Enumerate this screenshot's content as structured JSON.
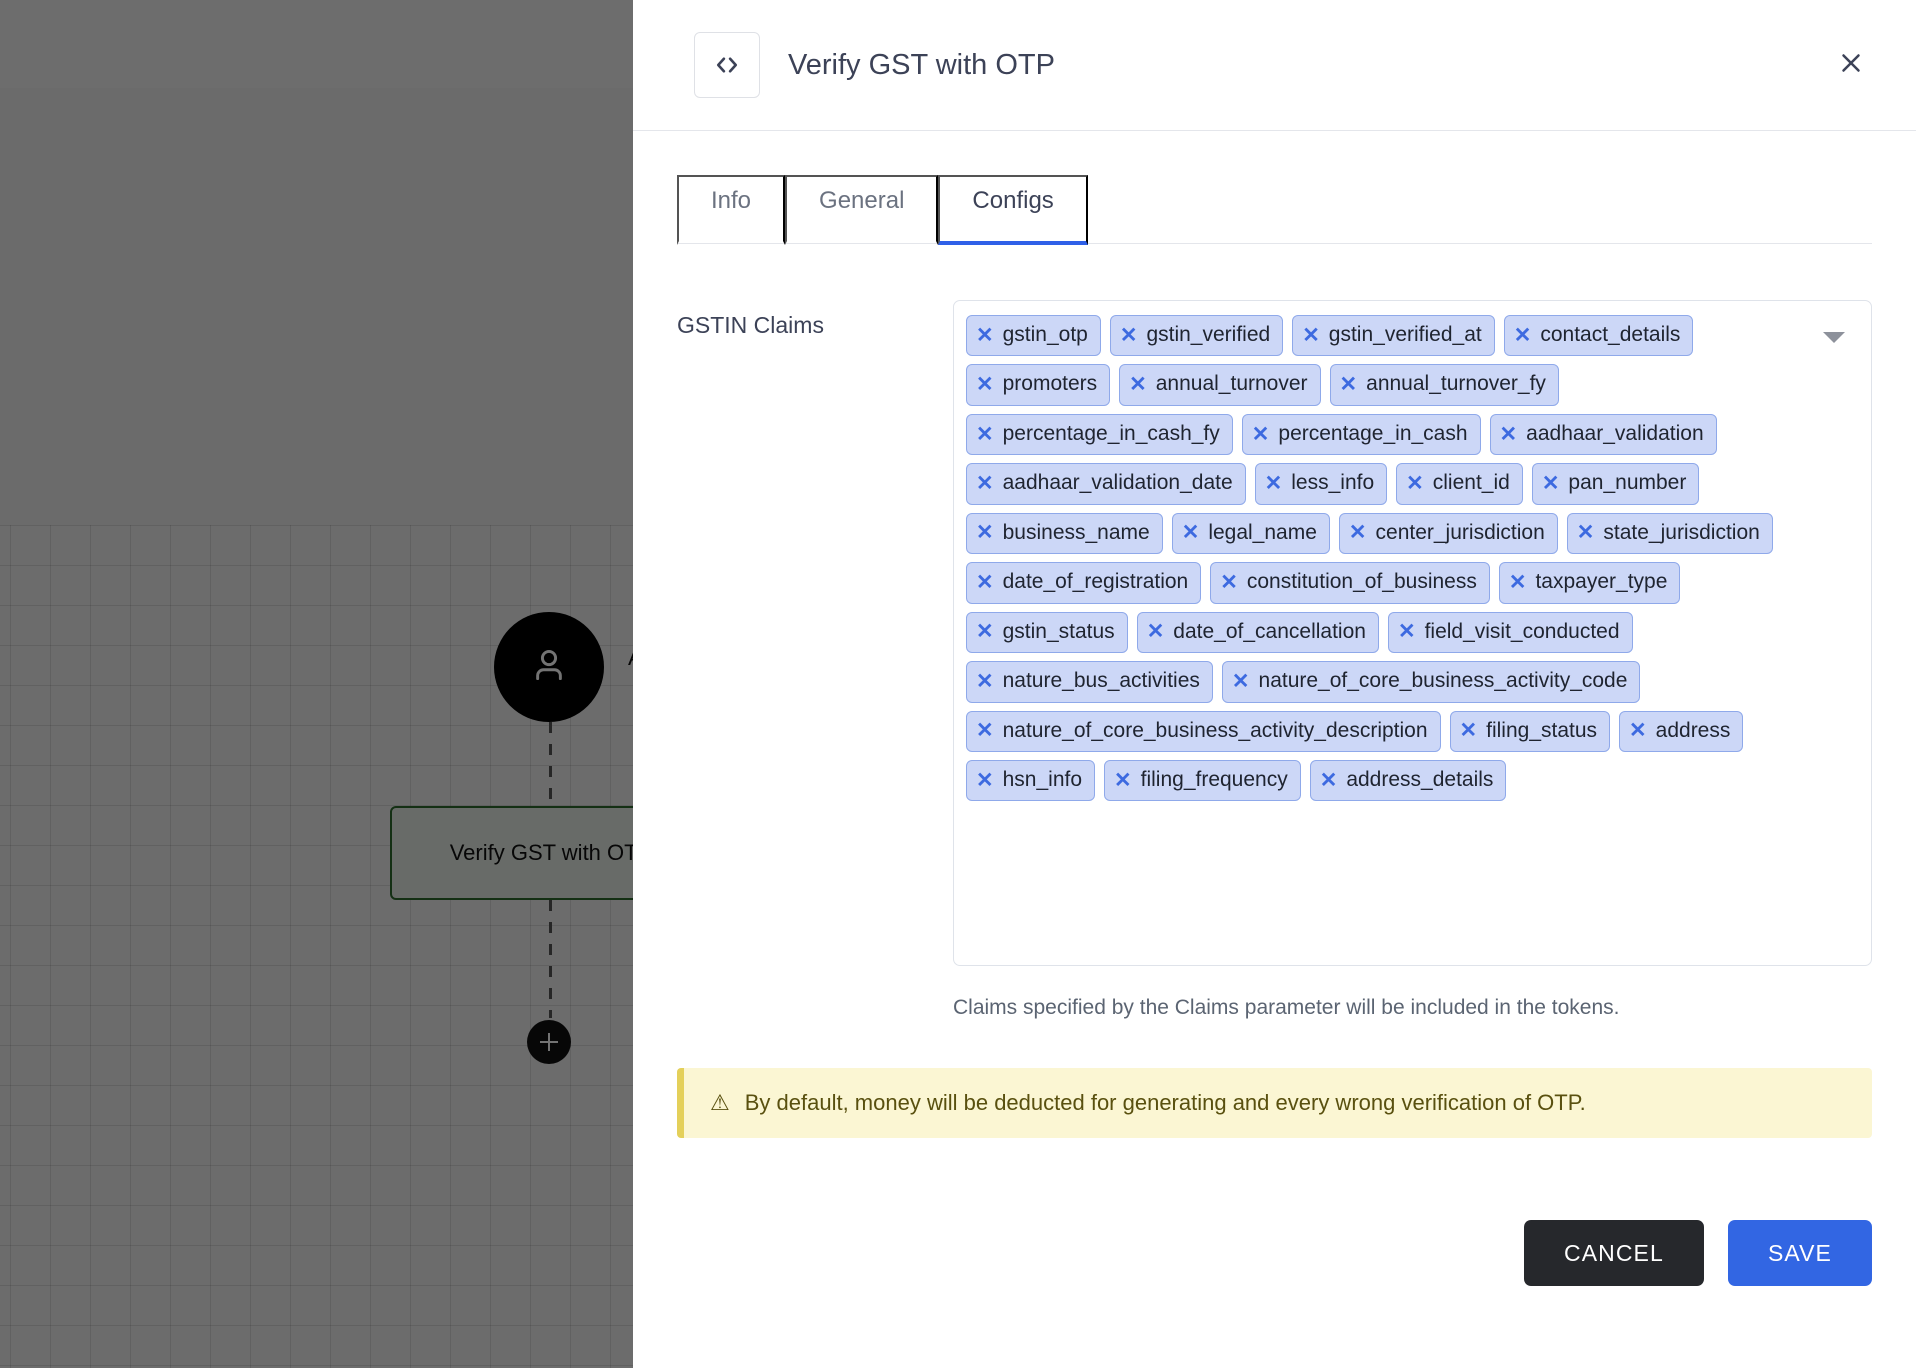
{
  "canvas": {
    "start_node_icon": "user-icon",
    "edge_label": "After User Con",
    "node_label": "Verify GST with OTP",
    "add_button_label": "+"
  },
  "drawer": {
    "icon": "code-brackets-icon",
    "title": "Verify GST with OTP",
    "close_icon": "close-icon",
    "tabs": [
      {
        "label": "Info",
        "active": false
      },
      {
        "label": "General",
        "active": false
      },
      {
        "label": "Configs",
        "active": true
      }
    ],
    "field": {
      "label": "GSTIN Claims",
      "dropdown_icon": "chevron-down-icon",
      "chips": [
        "gstin_otp",
        "gstin_verified",
        "gstin_verified_at",
        "contact_details",
        "promoters",
        "annual_turnover",
        "annual_turnover_fy",
        "percentage_in_cash_fy",
        "percentage_in_cash",
        "aadhaar_validation",
        "aadhaar_validation_date",
        "less_info",
        "client_id",
        "pan_number",
        "business_name",
        "legal_name",
        "center_jurisdiction",
        "state_jurisdiction",
        "date_of_registration",
        "constitution_of_business",
        "taxpayer_type",
        "gstin_status",
        "date_of_cancellation",
        "field_visit_conducted",
        "nature_bus_activities",
        "nature_of_core_business_activity_code",
        "nature_of_core_business_activity_description",
        "filing_status",
        "address",
        "hsn_info",
        "filing_frequency",
        "address_details"
      ],
      "remove_icon": "close-small-icon",
      "help_text": "Claims specified by the Claims parameter will be included in the tokens."
    },
    "warning": {
      "icon": "warning-triangle-icon",
      "text": "By default, money will be deducted for generating and every wrong verification of OTP."
    },
    "footer": {
      "cancel_label": "CANCEL",
      "save_label": "SAVE"
    }
  },
  "colors": {
    "accent": "#2f60e8",
    "save_button": "#3266e3",
    "cancel_button": "#26282c",
    "chip_bg": "#ccd7f7",
    "chip_border": "#8fa9ea",
    "chip_x": "#3d6ae0",
    "warning_bg": "#fbf6d3",
    "warning_border": "#e4d05a",
    "node_border": "#2e6b2e"
  }
}
